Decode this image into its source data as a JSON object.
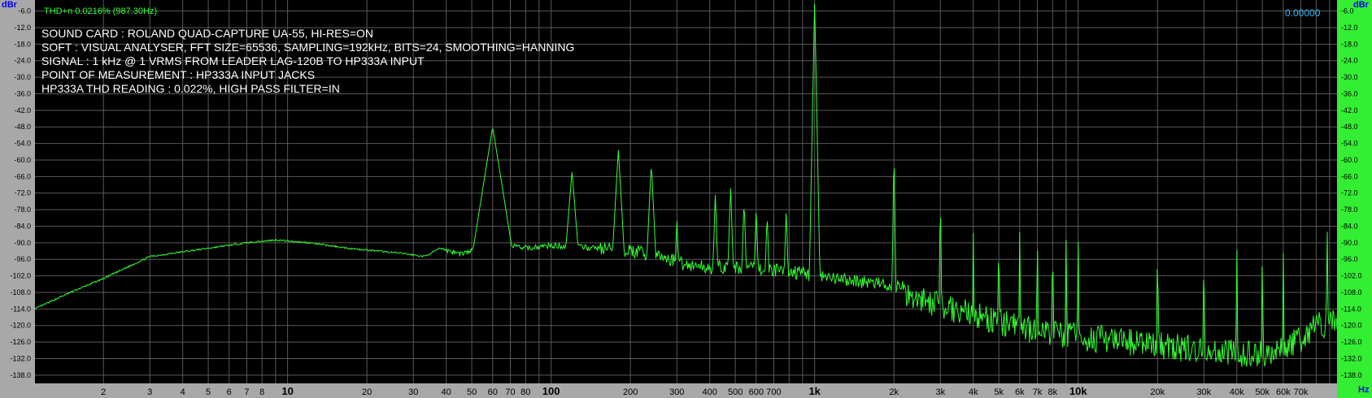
{
  "window": {
    "thd_readout": "THD+n 0.0216% (987.30Hz)",
    "value_readout": "0.00000",
    "y_unit_left": "dBr",
    "y_unit_right": "dBr",
    "x_unit": "Hz"
  },
  "info_lines": [
    "SOUND CARD : ROLAND QUAD-CAPTURE UA-55, HI-RES=ON",
    "SOFT : VISUAL ANALYSER, FFT SIZE=65536, SAMPLING=192kHz, BITS=24, SMOOTHING=HANNING",
    "SIGNAL : 1 kHz @ 1 VRMS FROM LEADER LAG-120B TO HP333A INPUT",
    "POINT OF MEASUREMENT : HP333A INPUT JACKS",
    "HP333A THD READING : 0.022%, HIGH PASS FILTER=IN"
  ],
  "colors": {
    "plot_background": "#000000",
    "grid": "#5a5a5a",
    "trace": "#33ff33",
    "left_axis_bg": "#a8a8a8",
    "right_axis_bg": "#33ee33",
    "info_text": "#ffffff"
  },
  "chart_data": {
    "type": "line",
    "title": "",
    "xlabel": "Hz",
    "ylabel": "dBr",
    "x_scale": "log",
    "xlim": [
      1.1,
      96000
    ],
    "ylim": [
      -141,
      -2
    ],
    "grid": true,
    "y_ticks": [
      -6.0,
      -12.0,
      -18.0,
      -24.0,
      -30.0,
      -36.0,
      -42.0,
      -48.0,
      -54.0,
      -60.0,
      -66.0,
      -72.0,
      -78.0,
      -84.0,
      -90.0,
      -96.0,
      -102.0,
      -108.0,
      -114.0,
      -120.0,
      -126.0,
      -132.0,
      -138.0
    ],
    "x_ticks": [
      {
        "value": 2,
        "label": "2",
        "major": false
      },
      {
        "value": 3,
        "label": "3",
        "major": false
      },
      {
        "value": 4,
        "label": "4",
        "major": false
      },
      {
        "value": 5,
        "label": "5",
        "major": false
      },
      {
        "value": 6,
        "label": "6",
        "major": false
      },
      {
        "value": 7,
        "label": "7",
        "major": false
      },
      {
        "value": 8,
        "label": "8",
        "major": false
      },
      {
        "value": 10,
        "label": "10",
        "major": true
      },
      {
        "value": 20,
        "label": "20",
        "major": false
      },
      {
        "value": 30,
        "label": "30",
        "major": false
      },
      {
        "value": 40,
        "label": "40",
        "major": false
      },
      {
        "value": 50,
        "label": "50",
        "major": false
      },
      {
        "value": 60,
        "label": "60",
        "major": false
      },
      {
        "value": 70,
        "label": "70",
        "major": false
      },
      {
        "value": 80,
        "label": "80",
        "major": false
      },
      {
        "value": 100,
        "label": "100",
        "major": true
      },
      {
        "value": 200,
        "label": "200",
        "major": false
      },
      {
        "value": 300,
        "label": "300",
        "major": false
      },
      {
        "value": 400,
        "label": "400",
        "major": false
      },
      {
        "value": 500,
        "label": "500",
        "major": false
      },
      {
        "value": 600,
        "label": "600",
        "major": false
      },
      {
        "value": 700,
        "label": "700",
        "major": false
      },
      {
        "value": 1000,
        "label": "1k",
        "major": true
      },
      {
        "value": 2000,
        "label": "2k",
        "major": false
      },
      {
        "value": 3000,
        "label": "3k",
        "major": false
      },
      {
        "value": 4000,
        "label": "4k",
        "major": false
      },
      {
        "value": 5000,
        "label": "5k",
        "major": false
      },
      {
        "value": 6000,
        "label": "6k",
        "major": false
      },
      {
        "value": 7000,
        "label": "7k",
        "major": false
      },
      {
        "value": 8000,
        "label": "8k",
        "major": false
      },
      {
        "value": 10000,
        "label": "10k",
        "major": true
      },
      {
        "value": 20000,
        "label": "20k",
        "major": false
      },
      {
        "value": 30000,
        "label": "30k",
        "major": false
      },
      {
        "value": 40000,
        "label": "40k",
        "major": false
      },
      {
        "value": 50000,
        "label": "50k",
        "major": false
      },
      {
        "value": 60000,
        "label": "60k",
        "major": false
      },
      {
        "value": 70000,
        "label": "70k",
        "major": false
      }
    ],
    "baseline": [
      [
        1.1,
        -114
      ],
      [
        1.5,
        -108
      ],
      [
        2,
        -103
      ],
      [
        3,
        -95
      ],
      [
        5,
        -92
      ],
      [
        7,
        -90
      ],
      [
        9,
        -89
      ],
      [
        12,
        -90
      ],
      [
        17,
        -92
      ],
      [
        22,
        -93
      ],
      [
        28,
        -94
      ],
      [
        33,
        -95
      ],
      [
        38,
        -92
      ],
      [
        45,
        -94
      ],
      [
        50,
        -93
      ],
      [
        55,
        -91
      ],
      [
        60,
        -90
      ],
      [
        70,
        -91
      ],
      [
        80,
        -92
      ],
      [
        100,
        -91
      ],
      [
        150,
        -92
      ],
      [
        200,
        -93
      ],
      [
        260,
        -95
      ],
      [
        330,
        -98
      ],
      [
        400,
        -99
      ],
      [
        500,
        -99
      ],
      [
        700,
        -100
      ],
      [
        900,
        -101
      ],
      [
        1100,
        -103
      ],
      [
        1500,
        -104
      ],
      [
        2000,
        -106
      ],
      [
        2500,
        -110
      ],
      [
        3000,
        -113
      ],
      [
        4000,
        -116
      ],
      [
        5000,
        -119
      ],
      [
        7000,
        -122
      ],
      [
        10000,
        -124
      ],
      [
        15000,
        -126
      ],
      [
        20000,
        -127
      ],
      [
        30000,
        -129
      ],
      [
        40000,
        -130
      ],
      [
        50000,
        -130
      ],
      [
        60000,
        -128
      ],
      [
        70000,
        -125
      ],
      [
        80000,
        -120
      ],
      [
        96000,
        -119
      ]
    ],
    "peaks": [
      {
        "freq": 60,
        "level": -48,
        "width": 0.1
      },
      {
        "freq": 120,
        "level": -64,
        "width": 0.05
      },
      {
        "freq": 180,
        "level": -56,
        "width": 0.035
      },
      {
        "freq": 240,
        "level": -61,
        "width": 0.03
      },
      {
        "freq": 300,
        "level": -80,
        "width": 0.02
      },
      {
        "freq": 420,
        "level": -72,
        "width": 0.02
      },
      {
        "freq": 480,
        "level": -69,
        "width": 0.02
      },
      {
        "freq": 540,
        "level": -74,
        "width": 0.02
      },
      {
        "freq": 600,
        "level": -77,
        "width": 0.02
      },
      {
        "freq": 660,
        "level": -79,
        "width": 0.02
      },
      {
        "freq": 780,
        "level": -78,
        "width": 0.02
      },
      {
        "freq": 1000,
        "level": -2,
        "width": 0.012
      },
      {
        "freq": 2000,
        "level": -53,
        "width": 0.008
      },
      {
        "freq": 3000,
        "level": -70,
        "width": 0.007
      },
      {
        "freq": 4000,
        "level": -85,
        "width": 0.006
      },
      {
        "freq": 5000,
        "level": -84,
        "width": 0.006
      },
      {
        "freq": 6000,
        "level": -84,
        "width": 0.006
      },
      {
        "freq": 7000,
        "level": -85,
        "width": 0.006
      },
      {
        "freq": 8000,
        "level": -86,
        "width": 0.006
      },
      {
        "freq": 9000,
        "level": -86,
        "width": 0.006
      },
      {
        "freq": 10000,
        "level": -87,
        "width": 0.006
      },
      {
        "freq": 20000,
        "level": -85,
        "width": 0.005
      },
      {
        "freq": 30000,
        "level": -88,
        "width": 0.005
      },
      {
        "freq": 40000,
        "level": -88,
        "width": 0.005
      },
      {
        "freq": 50000,
        "level": -89,
        "width": 0.005
      },
      {
        "freq": 60000,
        "level": -90,
        "width": 0.005
      },
      {
        "freq": 88000,
        "level": -75,
        "width": 0.004
      }
    ]
  }
}
